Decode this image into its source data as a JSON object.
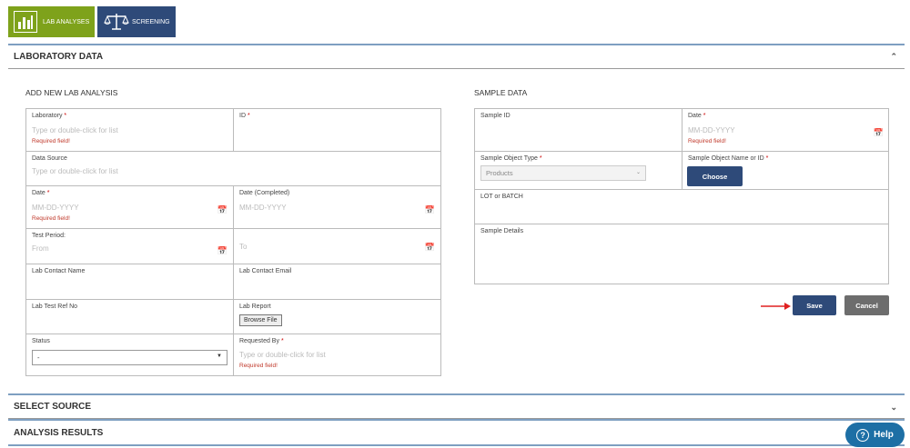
{
  "tabs": {
    "lab_analyses": "LAB ANALYSES",
    "screening": "SCREENING"
  },
  "sections": {
    "laboratory_data": "LABORATORY DATA",
    "select_source": "SELECT SOURCE",
    "analysis_results": "ANALYSIS RESULTS"
  },
  "add_new": {
    "title": "ADD NEW LAB ANALYSIS",
    "laboratory_label": "Laboratory",
    "laboratory_placeholder": "Type or double-click for list",
    "required_field": "Required field!",
    "id_label": "ID",
    "data_source_label": "Data Source",
    "data_source_placeholder": "Type or double-click for list",
    "date_label": "Date",
    "date_placeholder": "MM-DD-YYYY",
    "date_completed_label": "Date (Completed)",
    "date_completed_placeholder": "MM-DD-YYYY",
    "test_period_label": "Test Period:",
    "from_placeholder": "From",
    "to_placeholder": "To",
    "lab_contact_name_label": "Lab Contact Name",
    "lab_contact_email_label": "Lab Contact Email",
    "lab_test_ref_label": "Lab Test Ref No",
    "lab_report_label": "Lab Report",
    "browse_file": "Browse File",
    "status_label": "Status",
    "status_value": "-",
    "requested_by_label": "Requested By",
    "requested_by_placeholder": "Type or double-click for list"
  },
  "sample": {
    "title": "SAMPLE DATA",
    "sample_id_label": "Sample ID",
    "date_label": "Date",
    "date_placeholder": "MM-DD-YYYY",
    "required_field": "Required field!",
    "object_type_label": "Sample Object Type",
    "object_type_value": "Products",
    "object_name_label": "Sample Object Name or ID",
    "choose": "Choose",
    "lot_label": "LOT or BATCH",
    "details_label": "Sample Details"
  },
  "actions": {
    "save": "Save",
    "cancel": "Cancel",
    "help": "Help"
  },
  "required_mark": "*",
  "icons": {
    "lab": "bar-chart-icon",
    "screening": "scales-icon",
    "calendar": "calendar-icon",
    "arrow": "red-arrow-icon",
    "help": "question-icon"
  },
  "colors": {
    "lab_tab": "#7ea21b",
    "brand_blue": "#2e4a79",
    "required": "#c00000",
    "help": "#1d6fa5",
    "arrow": "#e02020"
  }
}
